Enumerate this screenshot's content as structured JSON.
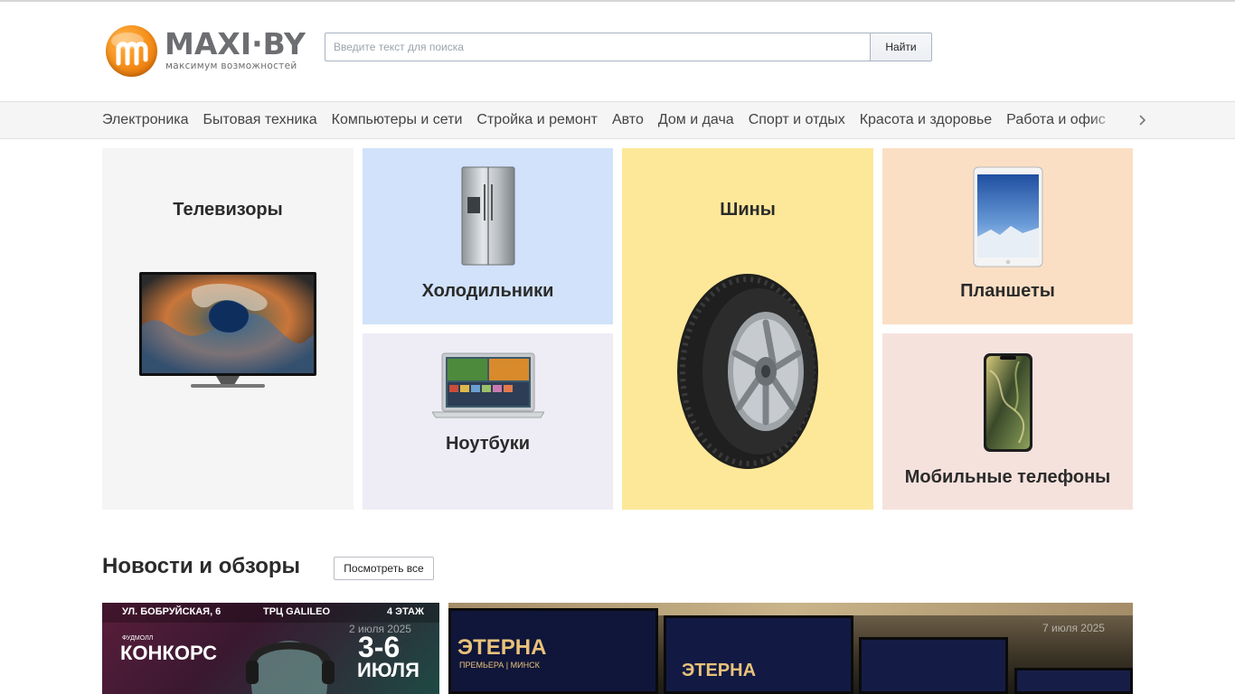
{
  "header": {
    "logo": {
      "name": "MAXI·BY",
      "tagline": "максимум возможностей"
    },
    "search": {
      "placeholder": "Введите текст для поиска",
      "value": "",
      "button_label": "Найти"
    }
  },
  "nav": {
    "items": [
      {
        "label": "Электроника"
      },
      {
        "label": "Бытовая техника"
      },
      {
        "label": "Компьютеры и сети"
      },
      {
        "label": "Стройка и ремонт"
      },
      {
        "label": "Авто"
      },
      {
        "label": "Дом и дача"
      },
      {
        "label": "Спорт и отдых"
      },
      {
        "label": "Красота и здоровье"
      },
      {
        "label": "Работа и офис"
      }
    ],
    "next_icon": "chevron-right-icon"
  },
  "tiles": {
    "tv": {
      "title": "Телевизоры",
      "color": "#f5f5f5",
      "image": "tv-image"
    },
    "fridge": {
      "title": "Холодильники",
      "color": "#d1e2fa",
      "image": "fridge-image"
    },
    "laptop": {
      "title": "Ноутбуки",
      "color": "#eeedf5",
      "image": "laptop-image"
    },
    "tires": {
      "title": "Шины",
      "color": "#fde899",
      "image": "tire-image"
    },
    "tablet": {
      "title": "Планшеты",
      "color": "#fbdfc4",
      "image": "tablet-image"
    },
    "phone": {
      "title": "Мобильные телефоны",
      "color": "#f6e2dd",
      "image": "phone-image"
    }
  },
  "news": {
    "title": "Новости и обзоры",
    "view_all_label": "Посмотреть все",
    "cards": [
      {
        "date": "2 июля 2025",
        "poster": {
          "top_left": "УЛ. БОБРУЙСКАЯ, 6",
          "top_mid": "ТРЦ GALILEO",
          "top_right": "4 ЭТАЖ",
          "brand_small": "ФУДМОЛЛ",
          "brand": "КОНКОРС",
          "days": "3-6",
          "month": "ИЮЛЯ"
        }
      },
      {
        "date": "7 июля 2025",
        "poster": {
          "title": "ЭТЕРНА",
          "subtitle": "ПРЕМЬЕРА | МИНСК"
        }
      }
    ]
  },
  "colors": {
    "accent": "#f7931e",
    "logo_gray": "#6d6e71"
  }
}
